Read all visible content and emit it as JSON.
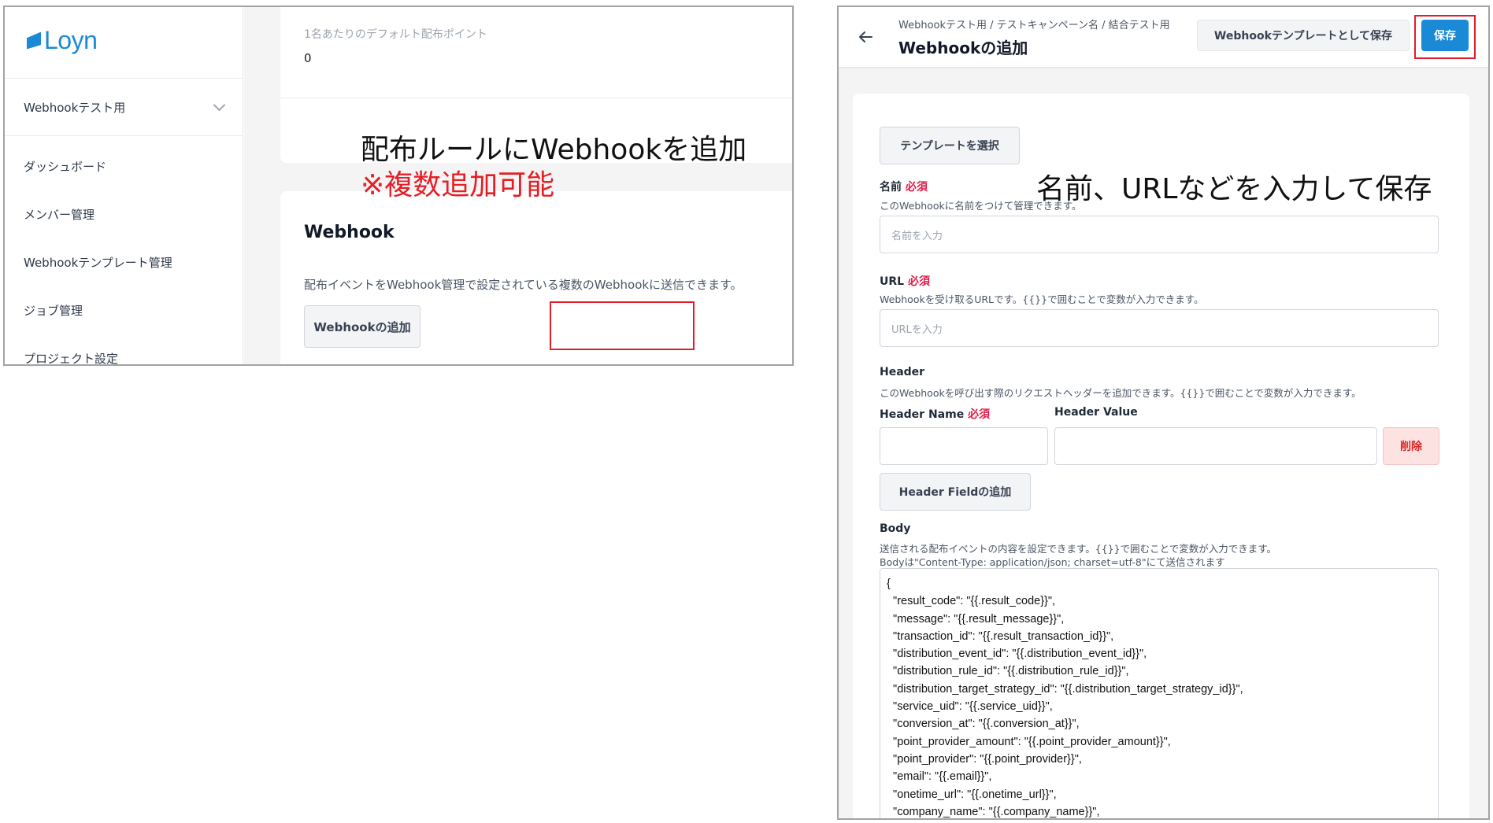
{
  "left": {
    "logo": "Loyn",
    "project_name": "Webhookテスト用",
    "nav": [
      "ダッシュボード",
      "メンバー管理",
      "Webhookテンプレート管理",
      "ジョブ管理",
      "プロジェクト設定"
    ],
    "default_points_label": "1名あたりのデフォルト配布ポイント",
    "default_points_value": "0",
    "webhook_heading": "Webhook",
    "webhook_desc": "配布イベントをWebhook管理で設定されている複数のWebhookに送信できます。",
    "add_webhook_button": "Webhookの追加",
    "annotation_line1": "配布ルールにWebhookを追加",
    "annotation_line2": "※複数追加可能"
  },
  "right": {
    "breadcrumb": "Webhookテスト用 / テストキャンペーン名 / 結合テスト用",
    "title": "Webhookの追加",
    "save_as_template_button": "Webhookテンプレートとして保存",
    "save_button": "保存",
    "annotation": "名前、URLなどを入力して保存",
    "select_template_button": "テンプレートを選択",
    "required_tag": "必須",
    "name_label": "名前",
    "name_help": "このWebhookに名前をつけて管理できます。",
    "name_placeholder": "名前を入力",
    "url_label": "URL",
    "url_help": "Webhookを受け取るURLです。{{}}で囲むことで変数が入力できます。",
    "url_placeholder": "URLを入力",
    "header_label": "Header",
    "header_help": "このWebhookを呼び出す際のリクエストヘッダーを追加できます。{{}}で囲むことで変数が入力できます。",
    "header_name_label": "Header Name",
    "header_value_label": "Header Value",
    "delete_button": "削除",
    "add_header_field_button": "Header Fieldの追加",
    "body_label": "Body",
    "body_help_1": "送信される配布イベントの内容を設定できます。{{}}で囲むことで変数が入力できます。",
    "body_help_2": "Bodyは\"Content-Type: application/json; charset=utf-8\"にて送信されます",
    "body_lines": [
      "{",
      "  \"result_code\": \"{{.result_code}}\",",
      "  \"message\": \"{{.result_message}}\",",
      "  \"transaction_id\": \"{{.result_transaction_id}}\",",
      "  \"distribution_event_id\": \"{{.distribution_event_id}}\",",
      "  \"distribution_rule_id\": \"{{.distribution_rule_id}}\",",
      "  \"distribution_target_strategy_id\": \"{{.distribution_target_strategy_id}}\",",
      "  \"service_uid\": \"{{.service_uid}}\",",
      "  \"conversion_at\": \"{{.conversion_at}}\",",
      "  \"point_provider_amount\": \"{{.point_provider_amount}}\",",
      "  \"point_provider\": \"{{.point_provider}}\",",
      "  \"email\": \"{{.email}}\",",
      "  \"onetime_url\": \"{{.onetime_url}}\",",
      "  \"company_name\": \"{{.company_name}}\","
    ]
  },
  "colors": {
    "brand": "#1a8ad6",
    "highlight": "#e11d2d",
    "required": "#e11d48",
    "annotation_red": "#e51e26"
  },
  "icons": {
    "logo": "loyn-logo-mark",
    "back": "arrow-left-icon",
    "project_toggle": "chevron-down-icon"
  }
}
